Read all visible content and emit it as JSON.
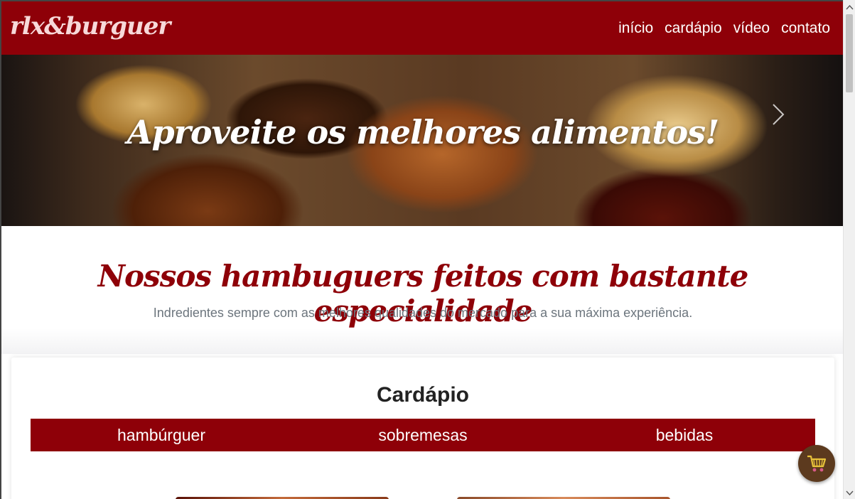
{
  "navbar": {
    "brand": "rlx&burguer",
    "links": [
      {
        "label": "início"
      },
      {
        "label": "cardápio"
      },
      {
        "label": "vídeo"
      },
      {
        "label": "contato"
      }
    ]
  },
  "hero": {
    "title": "Aproveite os melhores alimentos!",
    "next_icon": "chevron-right-icon"
  },
  "intro": {
    "title": "Nossos hambuguers feitos com bastante especialidade",
    "subtitle": "Indredientes sempre com as melhores qualidades do mercado para a sua máxima experiência."
  },
  "menu": {
    "title": "Cardápio",
    "tabs": [
      {
        "label": "hambúrguer"
      },
      {
        "label": "sobremesas"
      },
      {
        "label": "bebidas"
      }
    ]
  },
  "cart": {
    "icon": "shopping-cart-icon"
  },
  "colors": {
    "brand_red": "#8e0008",
    "cart_brown": "#5c3a1e",
    "muted_text": "#6c757d"
  }
}
